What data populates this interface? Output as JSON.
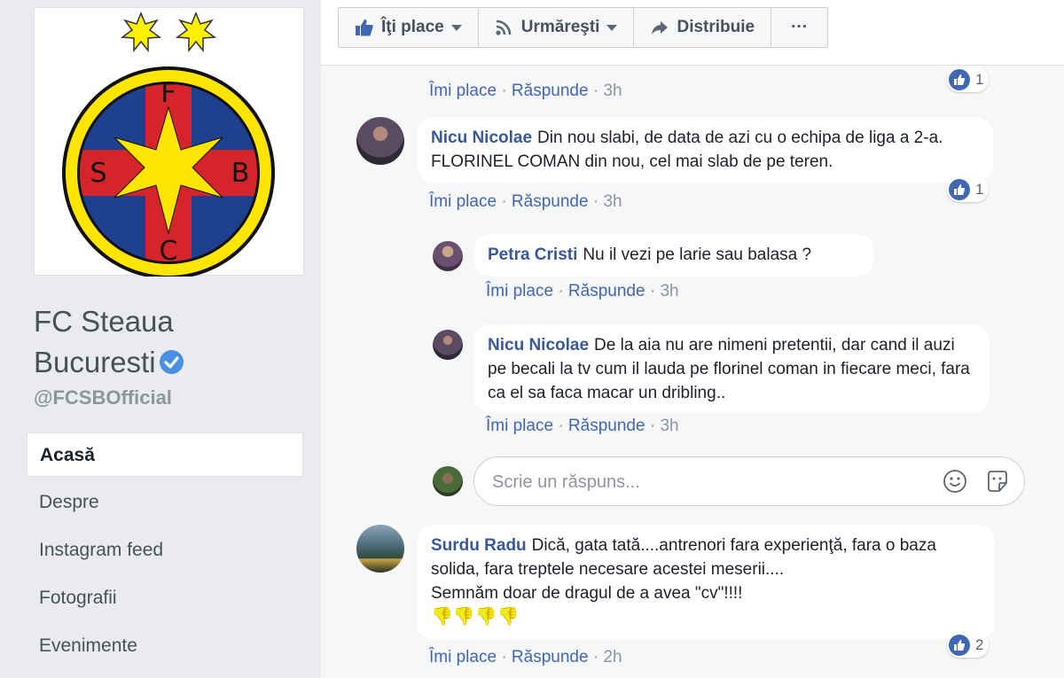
{
  "page": {
    "name": "FC Steaua Bucuresti",
    "handle": "@FCSBOfficial",
    "logo_letters": [
      "F",
      "S",
      "B",
      "C"
    ]
  },
  "nav": [
    {
      "label": "Acasă",
      "active": true
    },
    {
      "label": "Despre"
    },
    {
      "label": "Instagram feed"
    },
    {
      "label": "Fotografii"
    },
    {
      "label": "Evenimente"
    }
  ],
  "actions": {
    "like": "Îţi place",
    "follow": "Urmăreşti",
    "share": "Distribuie",
    "more": "···"
  },
  "labels": {
    "like": "Îmi place",
    "reply": "Răspunde",
    "sep": "·"
  },
  "comments": [
    {
      "time": "3h",
      "reactions": "1"
    },
    {
      "author": "Nicu Nicolae",
      "text": "Din nou slabi, de data de azi cu o echipa de liga a 2-a. FLORINEL COMAN din nou, cel mai slab de pe teren.",
      "time": "3h",
      "reactions": "1"
    },
    {
      "author": "Petra Cristi",
      "text": "Nu il vezi pe larie sau balasa ?",
      "time": "3h"
    },
    {
      "author": "Nicu Nicolae",
      "text": "De la aia nu are nimeni pretentii, dar cand il auzi pe becali la tv cum il lauda pe florinel coman in fiecare meci, fara ca el sa faca macar un dribling..",
      "time": "3h"
    },
    {
      "author": "Surdu Radu",
      "text": "Dică, gata tată....antrenori fara experienţă, fara o baza solida, fara treptele necesare acestei meserii....",
      "text2": "Semnăm doar de dragul de a avea \"cv\"!!!!",
      "emoji": "👎👎👎👎",
      "time": "2h",
      "reactions": "2"
    }
  ],
  "reply": {
    "placeholder": "Scrie un răspuns..."
  },
  "colors": {
    "accent": "#4267b2",
    "author": "#385898",
    "steaua_red": "#d6252a",
    "steaua_blue": "#1f3f8f",
    "steaua_yellow": "#ffe500"
  }
}
